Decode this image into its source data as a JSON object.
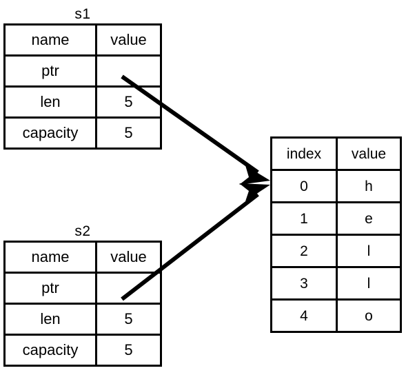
{
  "diagram": {
    "kind": "memory-layout-diagram",
    "ink_color": "#000000",
    "background_color": "#ffffff",
    "structs": [
      {
        "id": "s1",
        "title": "s1",
        "columns": [
          "name",
          "value"
        ],
        "rows": [
          {
            "name": "ptr",
            "value": ""
          },
          {
            "name": "len",
            "value": "5"
          },
          {
            "name": "capacity",
            "value": "5"
          }
        ]
      },
      {
        "id": "s2",
        "title": "s2",
        "columns": [
          "name",
          "value"
        ],
        "rows": [
          {
            "name": "ptr",
            "value": ""
          },
          {
            "name": "len",
            "value": "5"
          },
          {
            "name": "capacity",
            "value": "5"
          }
        ]
      }
    ],
    "buffer": {
      "columns": [
        "index",
        "value"
      ],
      "rows": [
        {
          "index": "0",
          "value": "h"
        },
        {
          "index": "1",
          "value": "e"
        },
        {
          "index": "2",
          "value": "l"
        },
        {
          "index": "3",
          "value": "l"
        },
        {
          "index": "4",
          "value": "o"
        }
      ]
    },
    "arrows": [
      {
        "id": "s1-ptr-to-buffer",
        "from": "s1.ptr",
        "to": "buffer.row0"
      },
      {
        "id": "s2-ptr-to-buffer",
        "from": "s2.ptr",
        "to": "buffer.row0"
      }
    ]
  }
}
